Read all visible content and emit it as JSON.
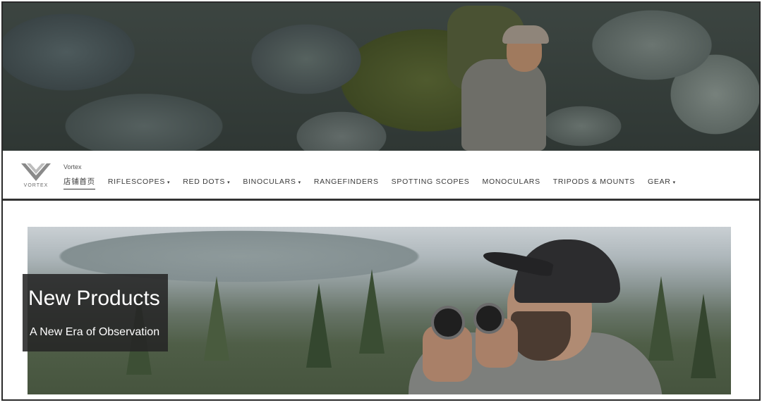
{
  "store": {
    "name": "Vortex",
    "logo_text": "VORTEX"
  },
  "nav": {
    "items": [
      {
        "label": "店铺首页",
        "dropdown": false,
        "active": true
      },
      {
        "label": "RIFLESCOPES",
        "dropdown": true,
        "active": false
      },
      {
        "label": "RED DOTS",
        "dropdown": true,
        "active": false
      },
      {
        "label": "BINOCULARS",
        "dropdown": true,
        "active": false
      },
      {
        "label": "RANGEFINDERS",
        "dropdown": false,
        "active": false
      },
      {
        "label": "SPOTTING SCOPES",
        "dropdown": false,
        "active": false
      },
      {
        "label": "MONOCULARS",
        "dropdown": false,
        "active": false
      },
      {
        "label": "TRIPODS & MOUNTS",
        "dropdown": false,
        "active": false
      },
      {
        "label": "GEAR",
        "dropdown": true,
        "active": false
      }
    ],
    "caret": "▾"
  },
  "promo": {
    "title": "New Products",
    "subtitle": "A New Era of Observation"
  },
  "colors": {
    "text": "#3a3a3a",
    "border": "#2b2b2b",
    "caption_bg": "#262626"
  }
}
